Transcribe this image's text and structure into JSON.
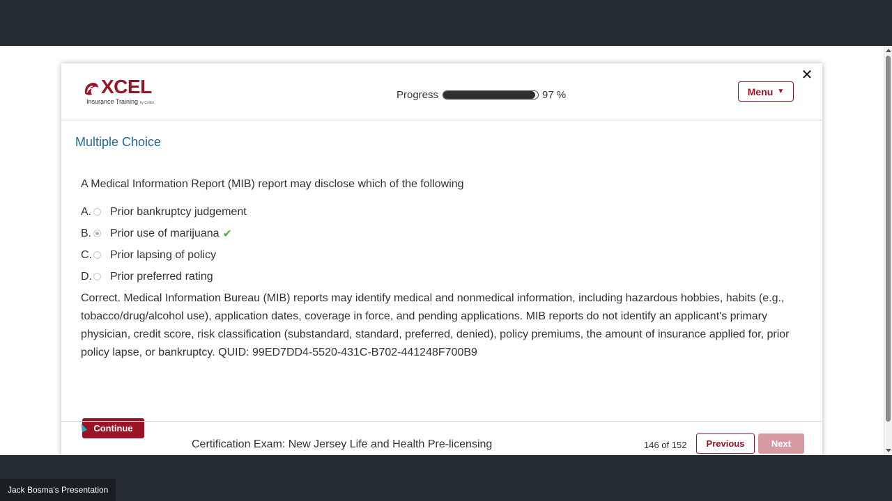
{
  "presentation": {
    "presenter_label": "Jack Bosma's Presentation"
  },
  "logo": {
    "word": "XCEL",
    "tagline": "Insurance Training",
    "tagline_small": "by Colibri",
    "brand_color": "#9b1426"
  },
  "header": {
    "progress_label": "Progress",
    "progress_fraction": 0.97,
    "progress_value_text": "97 %",
    "menu_label": "Menu",
    "menu_caret": "▼",
    "close_glyph": "✕"
  },
  "main": {
    "section_title": "Multiple Choice",
    "question": "A Medical Information Report (MIB) report may disclose which of the following",
    "options": [
      {
        "letter": "A.",
        "text": "Prior bankruptcy judgement",
        "selected": false,
        "correct": false
      },
      {
        "letter": "B.",
        "text": "Prior use of marijuana",
        "selected": true,
        "correct": true
      },
      {
        "letter": "C.",
        "text": "Prior lapsing of policy",
        "selected": false,
        "correct": false
      },
      {
        "letter": "D.",
        "text": "Prior preferred rating",
        "selected": false,
        "correct": false
      }
    ],
    "check_glyph": "✔",
    "feedback": "Correct. Medical Information Bureau (MIB) reports may identify medical and nonmedical information, including hazardous hobbies, habits (e.g., tobacco/drug/alcohol use), application dates, coverage in force, and pending applications. MIB reports do not identify an applicant's primary physician, credit score, risk classification (substandard, standard, preferred, denied), policy premiums, the amount of insurance applied for, prior policy lapse, or bankruptcy. QUID: 99ED7DD4-5520-431C-B702-441248F700B9",
    "continue_label": "Continue"
  },
  "footer": {
    "course_title": "Certification Exam: New Jersey Life and Health Pre-licensing",
    "page_counter": "146 of 152",
    "previous_label": "Previous",
    "next_label": "Next"
  },
  "colors": {
    "accent": "#9b1426",
    "title_blue": "#1f6a99",
    "correct_green": "#4caf50",
    "disabled_next": "#d79aa3"
  }
}
